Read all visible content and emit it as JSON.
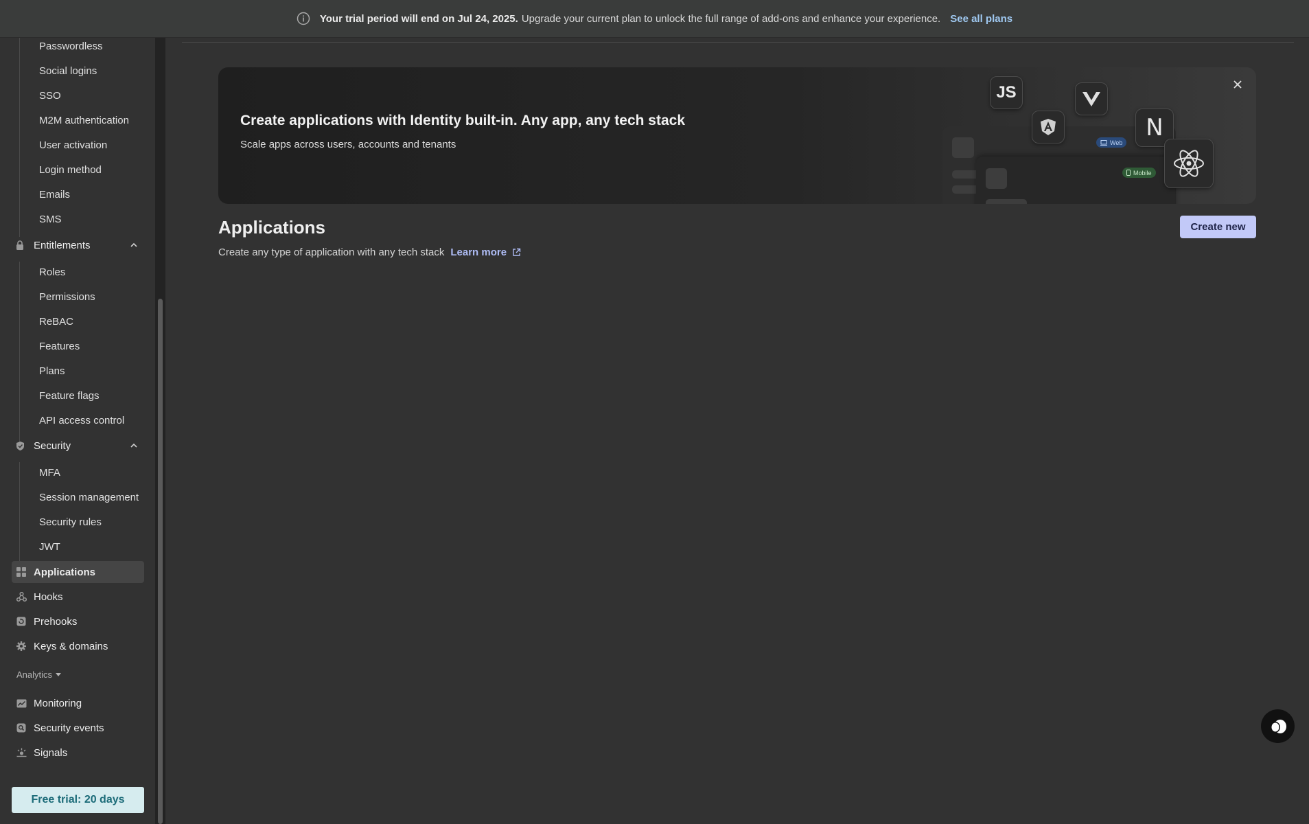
{
  "banner": {
    "bold_text": "Your trial period will end on Jul 24, 2025.",
    "text": "Upgrade your current plan to unlock the full range of add-ons and enhance your experience.",
    "link": "See all plans"
  },
  "sidebar": {
    "auth_subitems": [
      "Passwordless",
      "Social logins",
      "SSO",
      "M2M authentication",
      "User activation",
      "Login method",
      "Emails",
      "SMS"
    ],
    "entitlements": {
      "label": "Entitlements",
      "items": [
        "Roles",
        "Permissions",
        "ReBAC",
        "Features",
        "Plans",
        "Feature flags",
        "API access control"
      ]
    },
    "security": {
      "label": "Security",
      "items": [
        "MFA",
        "Session management",
        "Security rules",
        "JWT"
      ]
    },
    "nav": [
      "Applications",
      "Hooks",
      "Prehooks",
      "Keys & domains"
    ],
    "analytics_label": "Analytics",
    "analytics_items": [
      "Monitoring",
      "Security events",
      "Signals"
    ],
    "trial_button": "Free trial: 20 days"
  },
  "hero": {
    "title": "Create applications with Identity built-in. Any app, any tech stack",
    "subtitle": "Scale apps across users, accounts and tenants",
    "js_label": "JS",
    "n_label": "N",
    "web_pill": "Web",
    "mobile_pill": "Mobile"
  },
  "page": {
    "title": "Applications",
    "subtitle": "Create any type of application with any tech stack",
    "learn_more": "Learn more",
    "create_button": "Create new"
  }
}
